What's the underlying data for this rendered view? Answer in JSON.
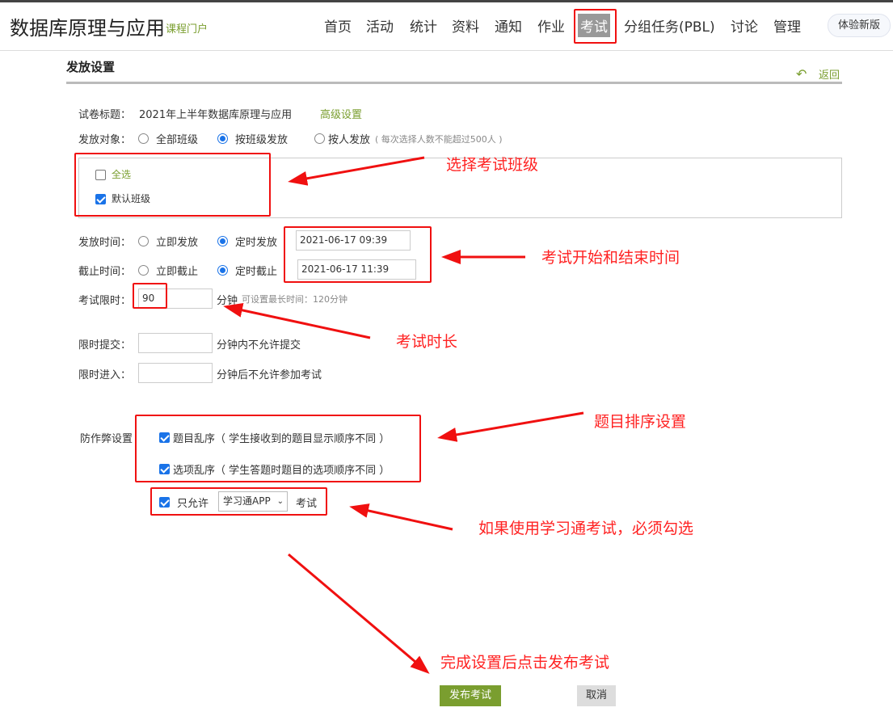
{
  "header": {
    "course_title": "数据库原理与应用",
    "portal_label": "课程门户",
    "nav": [
      "首页",
      "活动",
      "统计",
      "资料",
      "通知",
      "作业",
      "考试",
      "分组任务(PBL)",
      "讨论",
      "管理"
    ],
    "active_nav": "考试",
    "new_version_label": "体验新版"
  },
  "page": {
    "title": "发放设置",
    "back_label": "返回"
  },
  "form": {
    "paper_title_label": "试卷标题：",
    "paper_title": "2021年上半年数据库原理与应用",
    "advanced_label": "高级设置",
    "target_label": "发放对象：",
    "target_options": [
      "全部班级",
      "按班级发放",
      "按人发放"
    ],
    "target_selected": "按班级发放",
    "target_hint": "( 每次选择人数不能超过500人 )",
    "classes": {
      "select_all": "全选",
      "select_all_checked": false,
      "items": [
        {
          "name": "默认班级",
          "checked": true
        }
      ]
    },
    "publish_time_label": "发放时间：",
    "publish_options": [
      "立即发放",
      "定时发放"
    ],
    "publish_selected": "定时发放",
    "publish_time": "2021-06-17 09:39",
    "deadline_label": "截止时间：",
    "deadline_options": [
      "立即截止",
      "定时截止"
    ],
    "deadline_selected": "定时截止",
    "deadline_time": "2021-06-17 11:39",
    "limit_label": "考试限时：",
    "limit_value": "90",
    "limit_unit": "分钟",
    "limit_hint": "可设置最长时间：120分钟",
    "submit_limit_label": "限时提交：",
    "submit_limit_value": "",
    "submit_limit_suffix": "分钟内不允许提交",
    "enter_limit_label": "限时进入：",
    "enter_limit_value": "",
    "enter_limit_suffix": "分钟后不允许参加考试",
    "anticheat_label": "防作弊设置",
    "shuffle_questions": {
      "label": "题目乱序（ 学生接收到的题目显示顺序不同 ）",
      "checked": true
    },
    "shuffle_options": {
      "label": "选项乱序（ 学生答题时题目的选项顺序不同 ）",
      "checked": true
    },
    "only_allow": {
      "label": "只允许",
      "checked": true,
      "selected": "学习通APP",
      "suffix": "考试"
    }
  },
  "actions": {
    "publish": "发布考试",
    "cancel": "取消"
  },
  "annotations": [
    "选择考试班级",
    "考试开始和结束时间",
    "考试时长",
    "题目排序设置",
    "如果使用学习通考试，必须勾选",
    "完成设置后点击发布考试"
  ],
  "colors": {
    "accent_green": "#7a9e2f",
    "annotation_red": "#f01010",
    "radio_blue": "#1a73e8"
  }
}
